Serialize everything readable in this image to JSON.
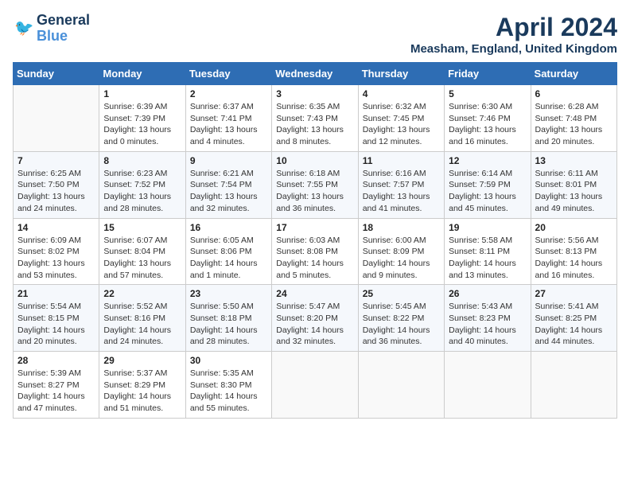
{
  "header": {
    "logo_line1": "General",
    "logo_line2": "Blue",
    "month_title": "April 2024",
    "location": "Measham, England, United Kingdom"
  },
  "weekdays": [
    "Sunday",
    "Monday",
    "Tuesday",
    "Wednesday",
    "Thursday",
    "Friday",
    "Saturday"
  ],
  "weeks": [
    [
      {
        "day": "",
        "info": ""
      },
      {
        "day": "1",
        "info": "Sunrise: 6:39 AM\nSunset: 7:39 PM\nDaylight: 13 hours\nand 0 minutes."
      },
      {
        "day": "2",
        "info": "Sunrise: 6:37 AM\nSunset: 7:41 PM\nDaylight: 13 hours\nand 4 minutes."
      },
      {
        "day": "3",
        "info": "Sunrise: 6:35 AM\nSunset: 7:43 PM\nDaylight: 13 hours\nand 8 minutes."
      },
      {
        "day": "4",
        "info": "Sunrise: 6:32 AM\nSunset: 7:45 PM\nDaylight: 13 hours\nand 12 minutes."
      },
      {
        "day": "5",
        "info": "Sunrise: 6:30 AM\nSunset: 7:46 PM\nDaylight: 13 hours\nand 16 minutes."
      },
      {
        "day": "6",
        "info": "Sunrise: 6:28 AM\nSunset: 7:48 PM\nDaylight: 13 hours\nand 20 minutes."
      }
    ],
    [
      {
        "day": "7",
        "info": "Sunrise: 6:25 AM\nSunset: 7:50 PM\nDaylight: 13 hours\nand 24 minutes."
      },
      {
        "day": "8",
        "info": "Sunrise: 6:23 AM\nSunset: 7:52 PM\nDaylight: 13 hours\nand 28 minutes."
      },
      {
        "day": "9",
        "info": "Sunrise: 6:21 AM\nSunset: 7:54 PM\nDaylight: 13 hours\nand 32 minutes."
      },
      {
        "day": "10",
        "info": "Sunrise: 6:18 AM\nSunset: 7:55 PM\nDaylight: 13 hours\nand 36 minutes."
      },
      {
        "day": "11",
        "info": "Sunrise: 6:16 AM\nSunset: 7:57 PM\nDaylight: 13 hours\nand 41 minutes."
      },
      {
        "day": "12",
        "info": "Sunrise: 6:14 AM\nSunset: 7:59 PM\nDaylight: 13 hours\nand 45 minutes."
      },
      {
        "day": "13",
        "info": "Sunrise: 6:11 AM\nSunset: 8:01 PM\nDaylight: 13 hours\nand 49 minutes."
      }
    ],
    [
      {
        "day": "14",
        "info": "Sunrise: 6:09 AM\nSunset: 8:02 PM\nDaylight: 13 hours\nand 53 minutes."
      },
      {
        "day": "15",
        "info": "Sunrise: 6:07 AM\nSunset: 8:04 PM\nDaylight: 13 hours\nand 57 minutes."
      },
      {
        "day": "16",
        "info": "Sunrise: 6:05 AM\nSunset: 8:06 PM\nDaylight: 14 hours\nand 1 minute."
      },
      {
        "day": "17",
        "info": "Sunrise: 6:03 AM\nSunset: 8:08 PM\nDaylight: 14 hours\nand 5 minutes."
      },
      {
        "day": "18",
        "info": "Sunrise: 6:00 AM\nSunset: 8:09 PM\nDaylight: 14 hours\nand 9 minutes."
      },
      {
        "day": "19",
        "info": "Sunrise: 5:58 AM\nSunset: 8:11 PM\nDaylight: 14 hours\nand 13 minutes."
      },
      {
        "day": "20",
        "info": "Sunrise: 5:56 AM\nSunset: 8:13 PM\nDaylight: 14 hours\nand 16 minutes."
      }
    ],
    [
      {
        "day": "21",
        "info": "Sunrise: 5:54 AM\nSunset: 8:15 PM\nDaylight: 14 hours\nand 20 minutes."
      },
      {
        "day": "22",
        "info": "Sunrise: 5:52 AM\nSunset: 8:16 PM\nDaylight: 14 hours\nand 24 minutes."
      },
      {
        "day": "23",
        "info": "Sunrise: 5:50 AM\nSunset: 8:18 PM\nDaylight: 14 hours\nand 28 minutes."
      },
      {
        "day": "24",
        "info": "Sunrise: 5:47 AM\nSunset: 8:20 PM\nDaylight: 14 hours\nand 32 minutes."
      },
      {
        "day": "25",
        "info": "Sunrise: 5:45 AM\nSunset: 8:22 PM\nDaylight: 14 hours\nand 36 minutes."
      },
      {
        "day": "26",
        "info": "Sunrise: 5:43 AM\nSunset: 8:23 PM\nDaylight: 14 hours\nand 40 minutes."
      },
      {
        "day": "27",
        "info": "Sunrise: 5:41 AM\nSunset: 8:25 PM\nDaylight: 14 hours\nand 44 minutes."
      }
    ],
    [
      {
        "day": "28",
        "info": "Sunrise: 5:39 AM\nSunset: 8:27 PM\nDaylight: 14 hours\nand 47 minutes."
      },
      {
        "day": "29",
        "info": "Sunrise: 5:37 AM\nSunset: 8:29 PM\nDaylight: 14 hours\nand 51 minutes."
      },
      {
        "day": "30",
        "info": "Sunrise: 5:35 AM\nSunset: 8:30 PM\nDaylight: 14 hours\nand 55 minutes."
      },
      {
        "day": "",
        "info": ""
      },
      {
        "day": "",
        "info": ""
      },
      {
        "day": "",
        "info": ""
      },
      {
        "day": "",
        "info": ""
      }
    ]
  ]
}
